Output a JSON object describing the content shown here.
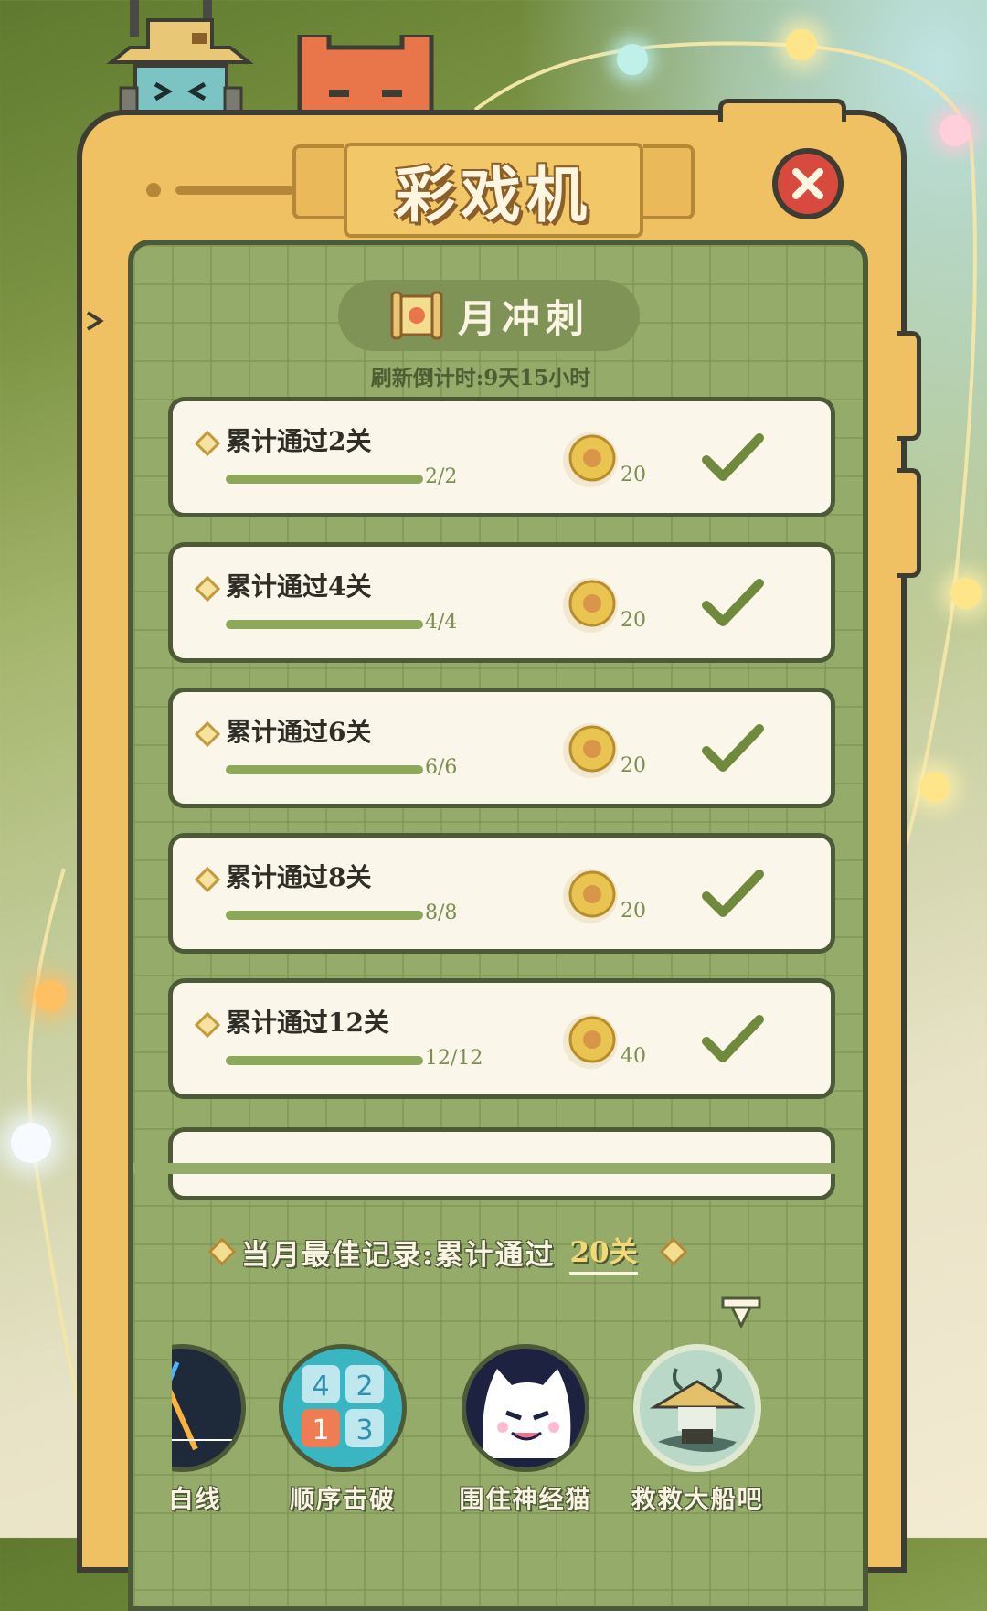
{
  "header": {
    "title": "彩戏机",
    "subtitle": "月冲刺",
    "countdown": "刷新倒计时:9天15小时"
  },
  "tasks": [
    {
      "label": "累计通过2关",
      "progress": "2/2",
      "reward": "20",
      "completed": true
    },
    {
      "label": "累计通过4关",
      "progress": "4/4",
      "reward": "20",
      "completed": true
    },
    {
      "label": "累计通过6关",
      "progress": "6/6",
      "reward": "20",
      "completed": true
    },
    {
      "label": "累计通过8关",
      "progress": "8/8",
      "reward": "20",
      "completed": true
    },
    {
      "label": "累计通过12关",
      "progress": "12/12",
      "reward": "40",
      "completed": true
    }
  ],
  "best_record": {
    "label": "当月最佳记录:累计通过",
    "value": "20关"
  },
  "games": [
    {
      "name": "碰白线",
      "icon": "lines-game-icon"
    },
    {
      "name": "顺序击破",
      "icon": "number-tiles-icon"
    },
    {
      "name": "围住神经猫",
      "icon": "cat-face-icon"
    },
    {
      "name": "救救大船吧",
      "icon": "boat-character-icon",
      "selected": true
    }
  ],
  "colors": {
    "frame": "#efc163",
    "screen": "#94ab6a",
    "card": "#faf6ea",
    "check": "#6f8a3c",
    "close": "#d94a3e"
  }
}
